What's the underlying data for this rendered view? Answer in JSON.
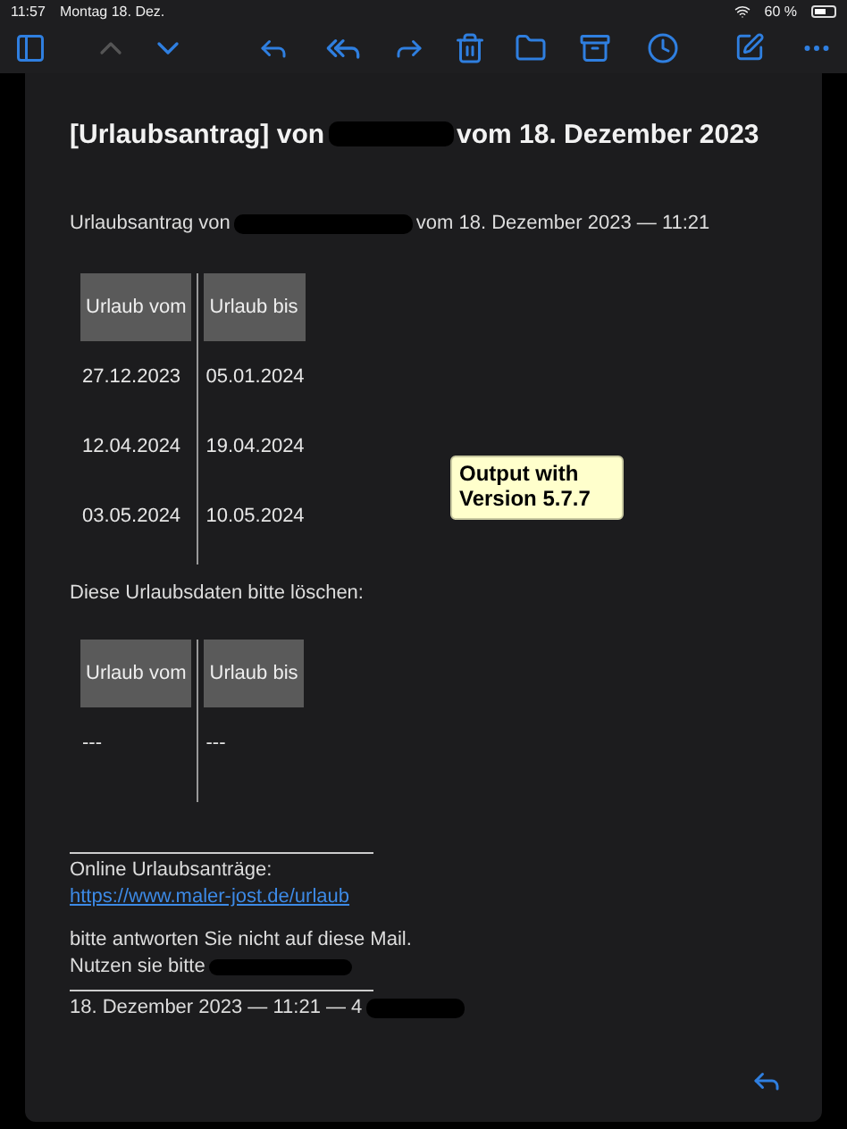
{
  "status_bar": {
    "time": "11:57",
    "date": "Montag 18. Dez.",
    "battery": "60 %"
  },
  "toolbar": {
    "nav": [
      {
        "kind": "up",
        "disabled": true
      },
      {
        "kind": "down",
        "disabled": false
      }
    ]
  },
  "mail": {
    "subject_start": "[Urlaubsantrag] von ",
    "subject_end": "vom 18. Dezember 2023",
    "intro_start": "Urlaubsantrag von ",
    "intro_end": "vom 18. Dezember 2023 — 11:21",
    "tables": [
      {
        "columns": [
          "Urlaub vom",
          "Urlaub bis"
        ],
        "rows": [
          [
            "27.12.2023",
            "05.01.2024"
          ],
          [
            "12.04.2024",
            "19.04.2024"
          ],
          [
            "03.05.2024",
            "10.05.2024"
          ]
        ]
      },
      {
        "caption": "Diese Urlaubsdaten bitte löschen:",
        "columns": [
          "Urlaub vom",
          "Urlaub bis"
        ],
        "rows": [
          [
            "---",
            "---"
          ]
        ]
      }
    ],
    "online_label": "Online Urlaubsanträge:",
    "online_link": "https://www.maler-jost.de/urlaub",
    "notice": "bitte antworten Sie nicht auf diese Mail.",
    "use_text": "Nutzen sie bitte ",
    "footer_start": "18. Dezember 2023 — 11:21 — 4"
  },
  "callout": "Output with Version 5.7.7"
}
